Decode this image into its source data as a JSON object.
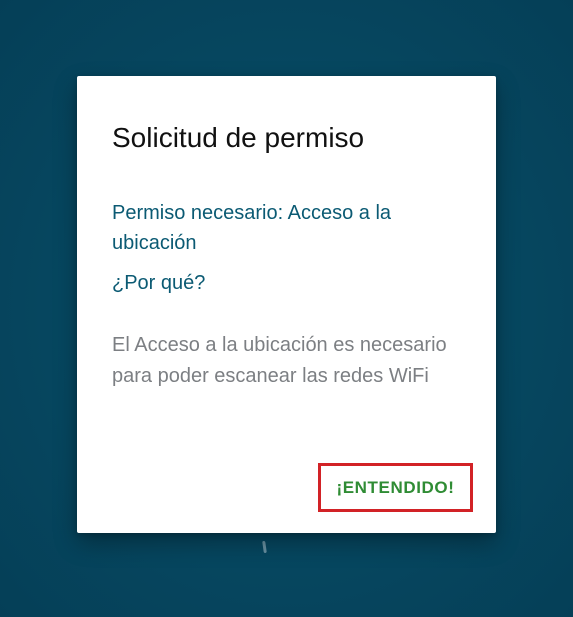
{
  "colors": {
    "background": "#064760",
    "dialog": "#ffffff",
    "title": "#111111",
    "link_text": "#0b5a73",
    "body_text": "#7c7f83",
    "button_text": "#2f8c34",
    "highlight_border": "#d22226"
  },
  "dialog": {
    "title": "Solicitud de permiso",
    "permission_required": "Permiso necesario: Acceso a la ubicación",
    "why_label": "¿Por qué?",
    "explanation": "El Acceso a la ubicación es necesario para poder escanear las redes WiFi",
    "confirm_label": "¡ENTENDIDO!"
  }
}
